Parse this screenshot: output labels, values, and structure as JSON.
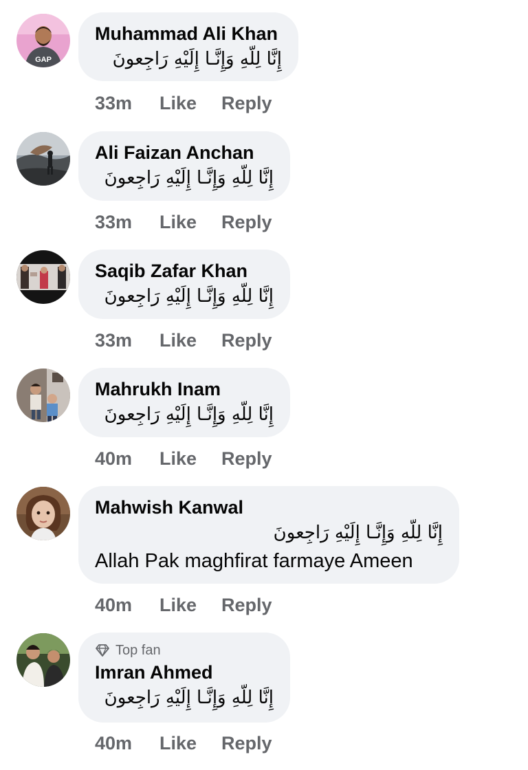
{
  "comments": [
    {
      "author": "Muhammad Ali Khan",
      "top_fan_label": "",
      "text_arabic": "إِنَّا لِلّهِ وَإِنَّـا إِلَيْهِ رَاجِعونَ",
      "text_extra": "",
      "time": "33m",
      "like_label": "Like",
      "reply_label": "Reply"
    },
    {
      "author": "Ali Faizan Anchan",
      "top_fan_label": "",
      "text_arabic": "إِنَّا لِلّهِ وَإِنَّـا إِلَيْهِ رَاجِعونَ",
      "text_extra": "",
      "time": "33m",
      "like_label": "Like",
      "reply_label": "Reply"
    },
    {
      "author": "Saqib Zafar Khan",
      "top_fan_label": "",
      "text_arabic": "إِنَّا لِلّهِ وَإِنَّـا إِلَيْهِ رَاجِعونَ",
      "text_extra": "",
      "time": "33m",
      "like_label": "Like",
      "reply_label": "Reply"
    },
    {
      "author": "Mahrukh Inam",
      "top_fan_label": "",
      "text_arabic": "إِنَّا لِلّهِ وَإِنَّـا إِلَيْهِ رَاجِعونَ",
      "text_extra": "",
      "time": "40m",
      "like_label": "Like",
      "reply_label": "Reply"
    },
    {
      "author": "Mahwish Kanwal",
      "top_fan_label": "",
      "text_arabic": "إِنَّا لِلّهِ وَإِنَّـا إِلَيْهِ رَاجِعونَ",
      "text_extra": "Allah Pak maghfirat farmaye Ameen",
      "time": "40m",
      "like_label": "Like",
      "reply_label": "Reply"
    },
    {
      "author": "Imran Ahmed",
      "top_fan_label": "Top fan",
      "text_arabic": "إِنَّا لِلّهِ وَإِنَّـا إِلَيْهِ رَاجِعونَ",
      "text_extra": "",
      "time": "40m",
      "like_label": "Like",
      "reply_label": "Reply"
    }
  ],
  "icons": {
    "top_fan": "diamond-badge-icon"
  },
  "colors": {
    "bubble": "#f0f2f5",
    "name": "#050505",
    "meta": "#65676b"
  }
}
